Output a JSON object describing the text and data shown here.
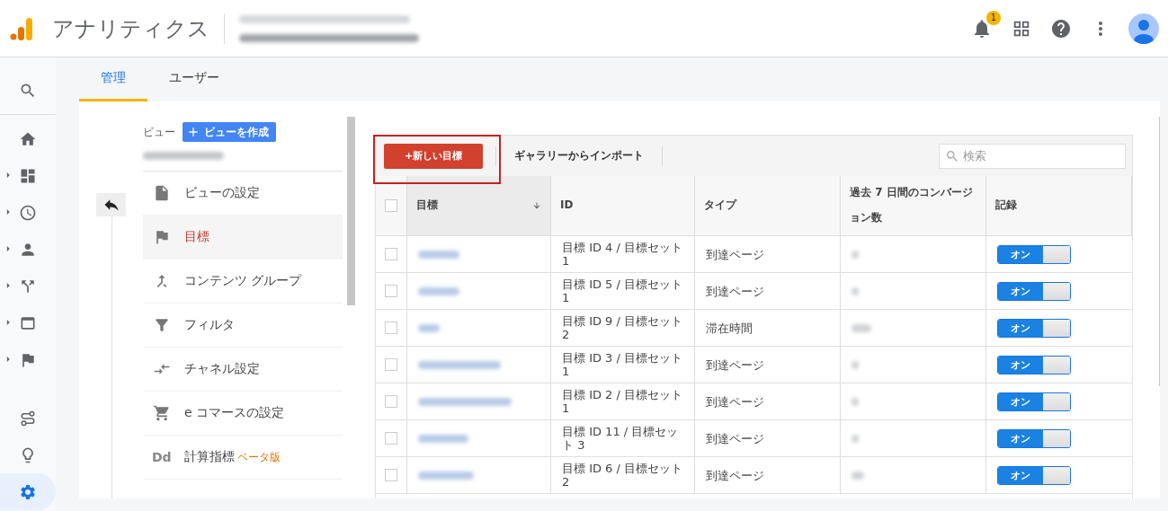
{
  "header": {
    "app_title": "アナリティクス",
    "notification_count": "1"
  },
  "nav_rail": [
    {
      "expandable": false,
      "selected": false
    },
    {
      "expandable": false,
      "selected": false
    },
    {
      "expandable": true,
      "selected": false
    },
    {
      "expandable": true,
      "selected": false
    },
    {
      "expandable": true,
      "selected": false
    },
    {
      "expandable": true,
      "selected": false
    },
    {
      "expandable": true,
      "selected": false
    },
    {
      "expandable": true,
      "selected": false
    },
    {
      "expandable": false,
      "selected": false
    },
    {
      "expandable": false,
      "selected": false
    },
    {
      "expandable": false,
      "selected": true
    }
  ],
  "tabs": [
    {
      "label": "管理",
      "selected": true
    },
    {
      "label": "ユーザー",
      "selected": false
    }
  ],
  "view_panel": {
    "label": "ビュー",
    "create_button": "ビューを作成",
    "menu": [
      {
        "label": "ビューの設定",
        "selected": false
      },
      {
        "label": "目標",
        "selected": true
      },
      {
        "label": "コンテンツ グループ",
        "selected": false
      },
      {
        "label": "フィルタ",
        "selected": false
      },
      {
        "label": "チャネル設定",
        "selected": false
      },
      {
        "label": "e コマースの設定",
        "selected": false
      },
      {
        "label": "計算指標",
        "badge": "ベータ版",
        "icon_text": "Dd",
        "selected": false
      }
    ]
  },
  "toolbar": {
    "new_goal_button": "+新しい目標",
    "highlighted": true,
    "import_button": "ギャラリーからインポート",
    "search": {
      "placeholder": "検索"
    }
  },
  "table": {
    "select_all_checked": false,
    "columns": [
      {
        "label": "目標",
        "sorted": true
      },
      {
        "label": "ID",
        "sorted": false
      },
      {
        "label": "タイプ",
        "sorted": false
      },
      {
        "label": "過去 7 日間のコンバージョン数",
        "sorted": false
      },
      {
        "label": "記録",
        "sorted": false
      }
    ],
    "rows": [
      {
        "checked": false,
        "id": "目標 ID 4 / 目標セット 1",
        "type": "到達ページ",
        "recording": {
          "label": "オン",
          "on": true
        }
      },
      {
        "checked": false,
        "id": "目標 ID 5 / 目標セット 1",
        "type": "到達ページ",
        "recording": {
          "label": "オン",
          "on": true
        }
      },
      {
        "checked": false,
        "id": "目標 ID 9 / 目標セット 2",
        "type": "滞在時間",
        "recording": {
          "label": "オン",
          "on": true
        }
      },
      {
        "checked": false,
        "id": "目標 ID 3 / 目標セット 1",
        "type": "到達ページ",
        "recording": {
          "label": "オン",
          "on": true
        }
      },
      {
        "checked": false,
        "id": "目標 ID 2 / 目標セット 1",
        "type": "到達ページ",
        "recording": {
          "label": "オン",
          "on": true
        }
      },
      {
        "checked": false,
        "id": "目標 ID 11 / 目標セット 3",
        "type": "到達ページ",
        "recording": {
          "label": "オン",
          "on": true
        }
      },
      {
        "checked": false,
        "id": "目標 ID 6 / 目標セット 2",
        "type": "到達ページ",
        "recording": {
          "label": "オン",
          "on": true
        }
      }
    ]
  }
}
